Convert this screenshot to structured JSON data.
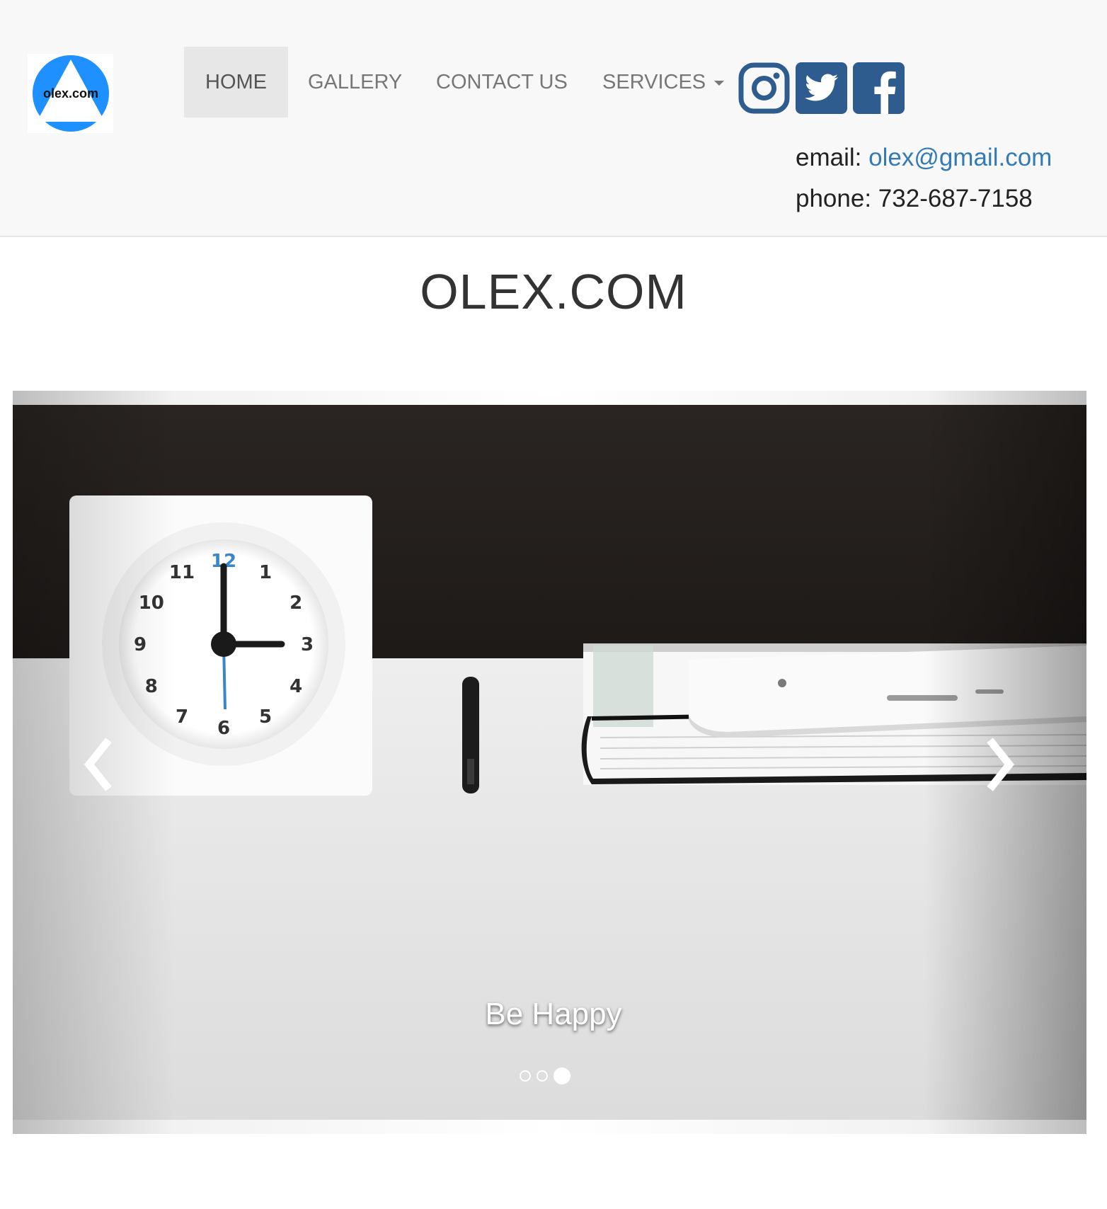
{
  "brand": {
    "logo_text": "olex.com",
    "logo_color": "#1e90ff"
  },
  "nav": {
    "items": [
      {
        "label": "HOME",
        "active": true
      },
      {
        "label": "GALLERY",
        "active": false
      },
      {
        "label": "CONTACT US",
        "active": false
      },
      {
        "label": "SERVICES",
        "active": false,
        "dropdown": true
      }
    ]
  },
  "social": [
    {
      "icon": "instagram-icon",
      "color": "#2f5c8e"
    },
    {
      "icon": "twitter-icon",
      "color": "#2f5c8e"
    },
    {
      "icon": "facebook-icon",
      "color": "#2f5c8e"
    }
  ],
  "contact": {
    "email_label": "email:",
    "email": "olex@gmail.com",
    "phone_label": "phone:",
    "phone": "732-687-7158"
  },
  "page_title": "OLEX.COM",
  "carousel": {
    "caption": "Be Happy",
    "indicator_count": 3,
    "active_indicator": 3,
    "clock_numbers": [
      "12",
      "1",
      "2",
      "3",
      "4",
      "5",
      "6",
      "7",
      "8",
      "9",
      "10",
      "11"
    ]
  },
  "colors": {
    "accent": "#337ab7",
    "nav_active_bg": "#e7e7e7",
    "navbar_bg": "#f8f8f8"
  }
}
